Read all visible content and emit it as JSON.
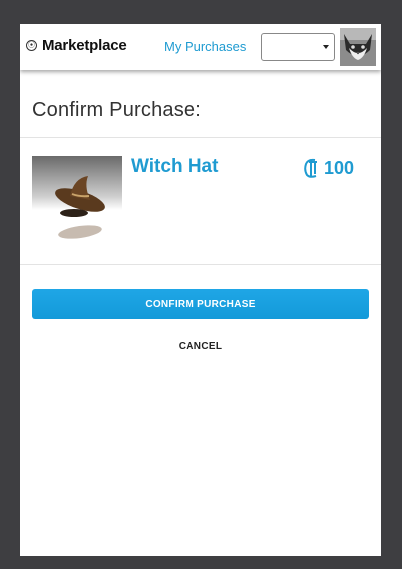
{
  "header": {
    "brand": "Marketplace",
    "my_purchases_label": "My Purchases",
    "user_select_value": "",
    "logo_icon": "marketplace-logo-icon",
    "avatar_icon": "cat-avatar"
  },
  "main": {
    "title": "Confirm Purchase:",
    "item": {
      "name": "Witch Hat",
      "price": "100",
      "currency_icon": "credit-currency-icon",
      "thumbnail_icon": "witch-hat-thumbnail"
    },
    "confirm_label": "CONFIRM PURCHASE",
    "cancel_label": "CANCEL"
  },
  "colors": {
    "accent": "#1f9bd1",
    "button": "#1aa0e0",
    "page_bg": "#3e3e41"
  }
}
